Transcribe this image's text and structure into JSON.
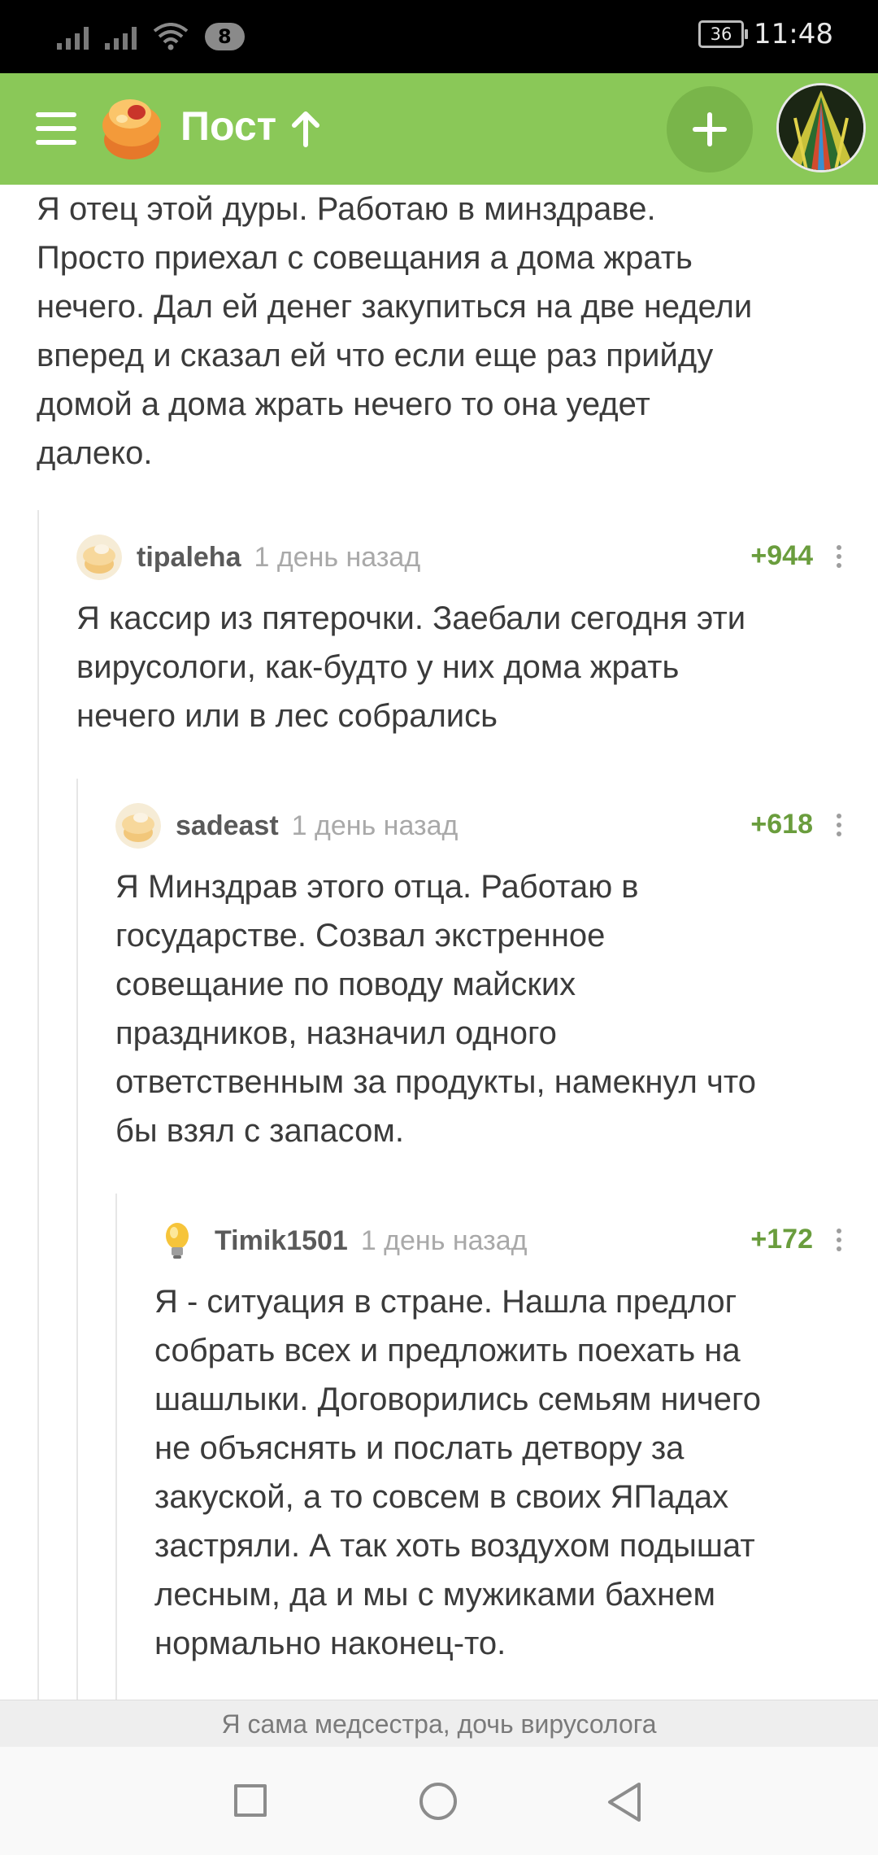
{
  "status_bar": {
    "notification_count": "8",
    "battery": "36",
    "time": "11:48",
    "icons": [
      "signal-icon",
      "signal-icon",
      "wifi-icon"
    ]
  },
  "app_bar": {
    "title": "Пост",
    "icons": [
      "menu-icon",
      "logo-icon",
      "arrow-up-icon",
      "add-icon",
      "avatar"
    ]
  },
  "post_text": "Я отец этой дуры. Работаю в минздраве.\nПросто приехал с совещания а дома жрать\nнечего. Дал ей денег закупиться на две недели\nвперед и сказал ей что если еще раз прийду\nдомой а дома жрать нечего то она уедет\nдалеко.",
  "comments": [
    {
      "user": "tipaleha",
      "time": "1 день назад",
      "rating": "+944",
      "text": "Я кассир из пятерочки. Заебали сегодня эти\nвирусологи, как-будто у них дома жрать\nнечего или в лес собрались"
    },
    {
      "user": "sadeast",
      "time": "1 день назад",
      "rating": "+618",
      "text": "Я Минздрав этого отца. Работаю в\nгосударстве. Созвал экстренное\nсовещание по поводу майских\nпраздников, назначил одного\nответственным за продукты, намекнул что\nбы взял с запасом."
    },
    {
      "user": "Timik1501",
      "time": "1 день назад",
      "rating": "+172",
      "text": "Я - ситуация в стране. Нашла предлог\nсобрать всех и предложить поехать на\nшашлыки. Договорились семьям ничего\nне объяснять и послать детвору за\nзакуской, а то совсем в своих ЯПадах\nзастряли. А так хоть воздухом подышат\nлесным, да и мы с мужиками бахнем\nнормально наконец-то."
    }
  ],
  "bottom_snippet": "Я сама медсестра, дочь вирусолога",
  "nav_bar": {
    "icons": [
      "recent-apps-icon",
      "home-icon",
      "back-icon"
    ]
  },
  "colors": {
    "accent": "#8ac858",
    "rating": "#6a9d3d",
    "text": "#3b3b3b",
    "muted": "#a9a9a9"
  }
}
